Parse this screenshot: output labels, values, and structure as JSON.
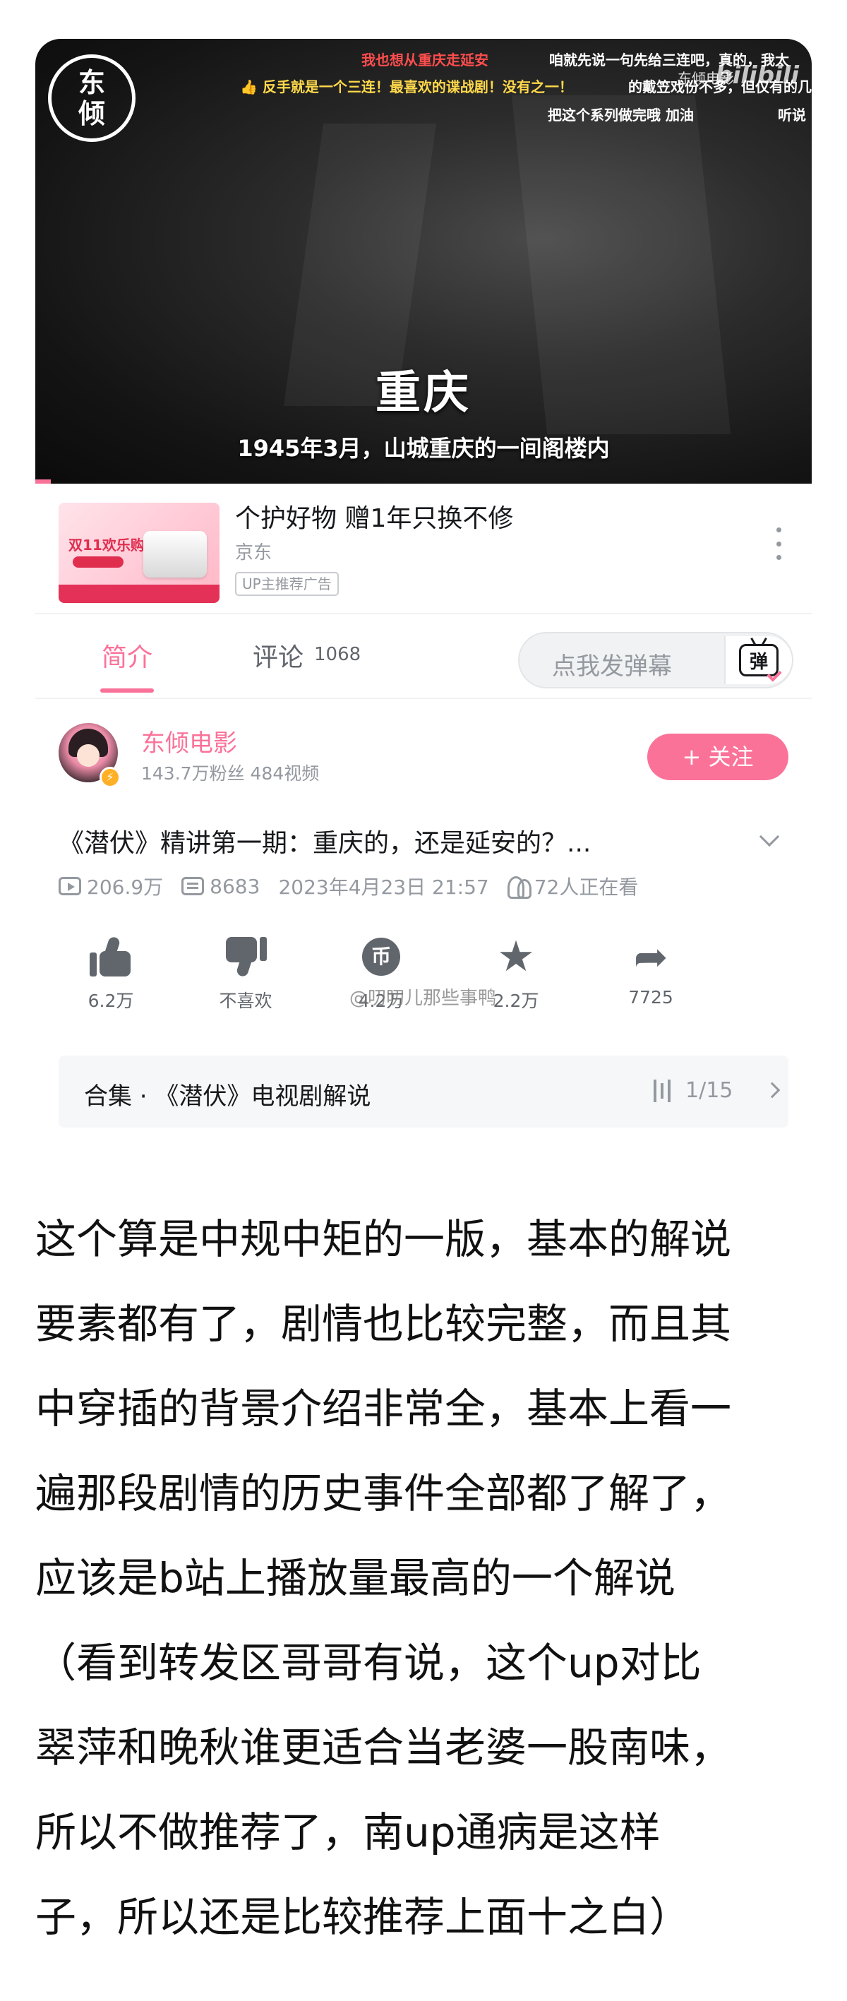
{
  "video": {
    "channel_logo_chars": [
      "东",
      "倾"
    ],
    "danmaku": [
      {
        "text": "我也想从重庆走延安",
        "color": "red"
      },
      {
        "text": "咱就先说一句先给三连吧，真的，我太",
        "color": "white"
      },
      {
        "text": "👍 反手就是一个三连！最喜欢的谍战剧！没有之一！",
        "color": "yellow"
      },
      {
        "text": "的戴笠戏份不多，但仅有的几",
        "color": "white"
      },
      {
        "text": "把这个系列做完哦 加油",
        "color": "white"
      },
      {
        "text": "听说",
        "color": "white"
      }
    ],
    "watermark_sub": "东倾电影",
    "watermark_logo": "bilibili",
    "caption_big": "重庆",
    "caption_sub": "1945年3月，山城重庆的一间阁楼内"
  },
  "ad": {
    "thumb_headline": "双11欢乐购",
    "title": "个护好物  赠1年只换不修",
    "brand": "京东",
    "tag": "UP主推荐广告"
  },
  "tabs": {
    "intro": "简介",
    "comments": "评论",
    "comments_count": "1068",
    "danmaku_placeholder": "点我发弹幕",
    "danmaku_button": "弹"
  },
  "uploader": {
    "name": "东倾电影",
    "stats": "143.7万粉丝  484视频",
    "follow": "+ 关注"
  },
  "video_info": {
    "title": "《潜伏》精讲第一期：重庆的，还是延安的？...",
    "views": "206.9万",
    "danmaku_count": "8683",
    "date": "2023年4月23日 21:57",
    "watching": "72人正在看"
  },
  "actions": {
    "like": "6.2万",
    "dislike": "不喜欢",
    "coin": "4.2万",
    "coin_glyph": "币",
    "favorite": "2.2万",
    "share": "7725"
  },
  "weibo_watermark": "@叨叨儿那些事鸭",
  "collection": {
    "label": "合集 · 《潜伏》电视剧解说",
    "page": "1/15"
  },
  "commentary": [
    "这个算是中规中矩的一版，基本的解说",
    "要素都有了，剧情也比较完整，而且其",
    "中穿插的背景介绍非常全，基本上看一",
    "遍那段剧情的历史事件全部都了解了，",
    "应该是b站上播放量最高的一个解说",
    "（看到转发区哥哥有说，这个up对比",
    "翠萍和晚秋谁更适合当老婆一股南味，",
    "所以不做推荐了，南up通病是这样",
    "子，所以还是比较推荐上面十之白）"
  ],
  "colors": {
    "accent": "#fb7299",
    "text_primary": "#18191c",
    "text_secondary": "#9499a0"
  }
}
